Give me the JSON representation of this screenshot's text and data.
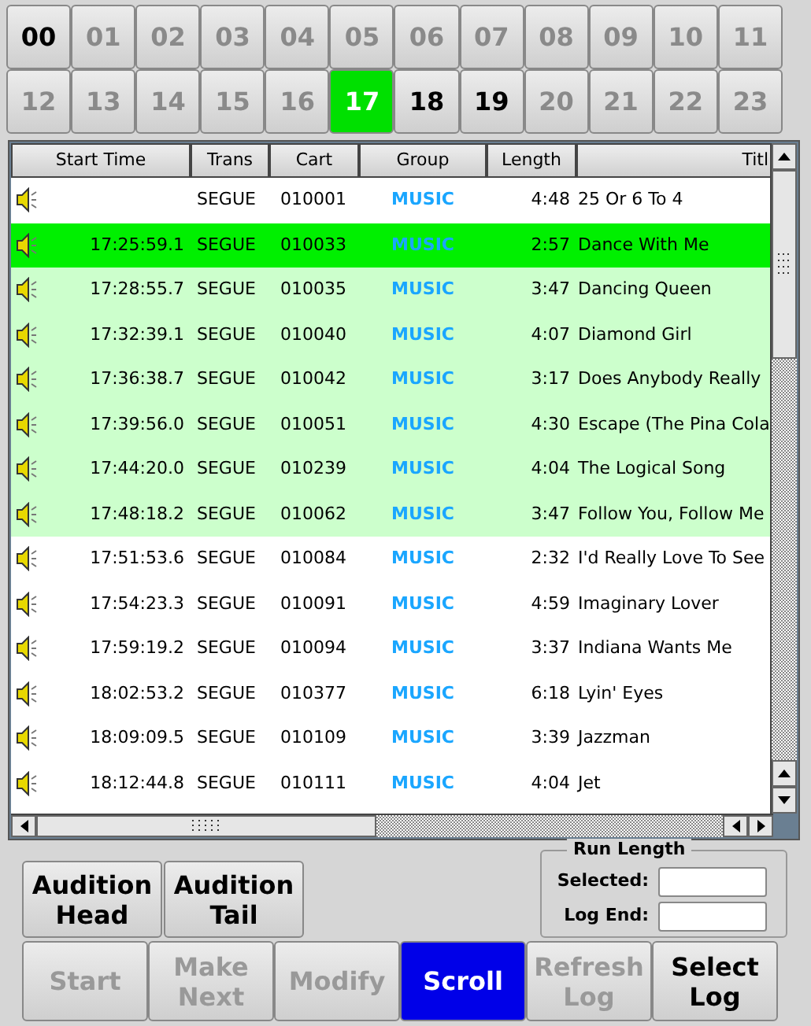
{
  "hours": [
    {
      "label": "00",
      "disabled": false,
      "selected": false
    },
    {
      "label": "01",
      "disabled": true,
      "selected": false
    },
    {
      "label": "02",
      "disabled": true,
      "selected": false
    },
    {
      "label": "03",
      "disabled": true,
      "selected": false
    },
    {
      "label": "04",
      "disabled": true,
      "selected": false
    },
    {
      "label": "05",
      "disabled": true,
      "selected": false
    },
    {
      "label": "06",
      "disabled": true,
      "selected": false
    },
    {
      "label": "07",
      "disabled": true,
      "selected": false
    },
    {
      "label": "08",
      "disabled": true,
      "selected": false
    },
    {
      "label": "09",
      "disabled": true,
      "selected": false
    },
    {
      "label": "10",
      "disabled": true,
      "selected": false
    },
    {
      "label": "11",
      "disabled": true,
      "selected": false
    },
    {
      "label": "12",
      "disabled": true,
      "selected": false
    },
    {
      "label": "13",
      "disabled": true,
      "selected": false
    },
    {
      "label": "14",
      "disabled": true,
      "selected": false
    },
    {
      "label": "15",
      "disabled": true,
      "selected": false
    },
    {
      "label": "16",
      "disabled": true,
      "selected": false
    },
    {
      "label": "17",
      "disabled": false,
      "selected": true
    },
    {
      "label": "18",
      "disabled": false,
      "selected": false
    },
    {
      "label": "19",
      "disabled": false,
      "selected": false
    },
    {
      "label": "20",
      "disabled": true,
      "selected": false
    },
    {
      "label": "21",
      "disabled": true,
      "selected": false
    },
    {
      "label": "22",
      "disabled": true,
      "selected": false
    },
    {
      "label": "23",
      "disabled": true,
      "selected": false
    }
  ],
  "table": {
    "columns": [
      "Start Time",
      "Trans",
      "Cart",
      "Group",
      "Length",
      "Titl"
    ],
    "rows": [
      {
        "playing": false,
        "played": false,
        "start_time": "",
        "trans": "SEGUE",
        "cart": "010001",
        "group": "MUSIC",
        "length": "4:48",
        "title": "25 Or 6 To 4"
      },
      {
        "playing": true,
        "played": false,
        "start_time": "17:25:59.1",
        "trans": "SEGUE",
        "cart": "010033",
        "group": "MUSIC",
        "length": "2:57",
        "title": "Dance With Me"
      },
      {
        "playing": false,
        "played": true,
        "start_time": "17:28:55.7",
        "trans": "SEGUE",
        "cart": "010035",
        "group": "MUSIC",
        "length": "3:47",
        "title": "Dancing Queen"
      },
      {
        "playing": false,
        "played": true,
        "start_time": "17:32:39.1",
        "trans": "SEGUE",
        "cart": "010040",
        "group": "MUSIC",
        "length": "4:07",
        "title": "Diamond Girl"
      },
      {
        "playing": false,
        "played": true,
        "start_time": "17:36:38.7",
        "trans": "SEGUE",
        "cart": "010042",
        "group": "MUSIC",
        "length": "3:17",
        "title": "Does Anybody Really"
      },
      {
        "playing": false,
        "played": true,
        "start_time": "17:39:56.0",
        "trans": "SEGUE",
        "cart": "010051",
        "group": "MUSIC",
        "length": "4:30",
        "title": "Escape (The Pina Cola"
      },
      {
        "playing": false,
        "played": true,
        "start_time": "17:44:20.0",
        "trans": "SEGUE",
        "cart": "010239",
        "group": "MUSIC",
        "length": "4:04",
        "title": "The Logical Song"
      },
      {
        "playing": false,
        "played": true,
        "start_time": "17:48:18.2",
        "trans": "SEGUE",
        "cart": "010062",
        "group": "MUSIC",
        "length": "3:47",
        "title": "Follow You, Follow Me"
      },
      {
        "playing": false,
        "played": false,
        "start_time": "17:51:53.6",
        "trans": "SEGUE",
        "cart": "010084",
        "group": "MUSIC",
        "length": "2:32",
        "title": "I'd Really Love To See"
      },
      {
        "playing": false,
        "played": false,
        "start_time": "17:54:23.3",
        "trans": "SEGUE",
        "cart": "010091",
        "group": "MUSIC",
        "length": "4:59",
        "title": "Imaginary Lover"
      },
      {
        "playing": false,
        "played": false,
        "start_time": "17:59:19.2",
        "trans": "SEGUE",
        "cart": "010094",
        "group": "MUSIC",
        "length": "3:37",
        "title": "Indiana Wants Me"
      },
      {
        "playing": false,
        "played": false,
        "start_time": "18:02:53.2",
        "trans": "SEGUE",
        "cart": "010377",
        "group": "MUSIC",
        "length": "6:18",
        "title": "Lyin' Eyes"
      },
      {
        "playing": false,
        "played": false,
        "start_time": "18:09:09.5",
        "trans": "SEGUE",
        "cart": "010109",
        "group": "MUSIC",
        "length": "3:39",
        "title": "Jazzman"
      },
      {
        "playing": false,
        "played": false,
        "start_time": "18:12:44.8",
        "trans": "SEGUE",
        "cart": "010111",
        "group": "MUSIC",
        "length": "4:04",
        "title": "Jet"
      }
    ]
  },
  "audition_buttons": [
    "Audition Head",
    "Audition Tail"
  ],
  "run_length": {
    "title": "Run Length",
    "selected_label": "Selected:",
    "log_end_label": "Log End:"
  },
  "buttons": [
    {
      "label": "Start",
      "disabled": true,
      "selected": false
    },
    {
      "label": "Make Next",
      "disabled": true,
      "selected": false
    },
    {
      "label": "Modify",
      "disabled": true,
      "selected": false
    },
    {
      "label": "Scroll",
      "disabled": false,
      "selected": true
    },
    {
      "label": "Refresh Log",
      "disabled": true,
      "selected": false
    },
    {
      "label": "Select Log",
      "disabled": false,
      "selected": false
    }
  ]
}
